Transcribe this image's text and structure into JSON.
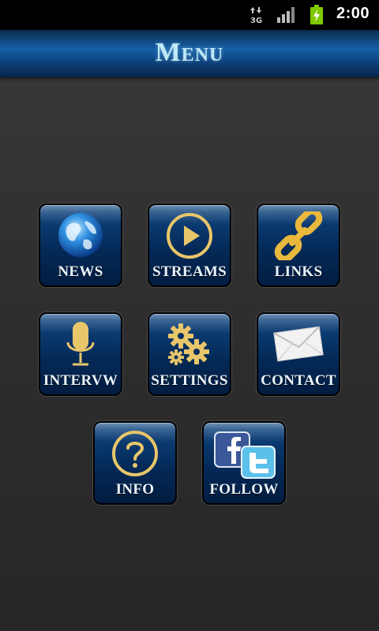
{
  "status_bar": {
    "network": "3G",
    "time": "2:00",
    "icons": [
      "data-arrows-icon",
      "signal-icon",
      "battery-charging-icon"
    ]
  },
  "header": {
    "title": "Menu"
  },
  "menu": {
    "items": [
      {
        "id": "news",
        "label": "NEWS",
        "icon": "globe-icon"
      },
      {
        "id": "streams",
        "label": "STREAMS",
        "icon": "play-circle-icon"
      },
      {
        "id": "links",
        "label": "LINKS",
        "icon": "chain-link-icon"
      },
      {
        "id": "interview",
        "label": "INTERVW",
        "icon": "microphone-icon"
      },
      {
        "id": "settings",
        "label": "SETTINGS",
        "icon": "gears-icon"
      },
      {
        "id": "contact",
        "label": "CONTACT",
        "icon": "envelope-icon"
      },
      {
        "id": "info",
        "label": "INFO",
        "icon": "question-circle-icon"
      },
      {
        "id": "follow",
        "label": "FOLLOW",
        "icon": "facebook-twitter-icon"
      }
    ]
  },
  "colors": {
    "accent_gold": "#e9c66a",
    "title_text": "#bfe9f5",
    "tile_blue": "#0b3a70",
    "background": "#2f2f2f"
  }
}
